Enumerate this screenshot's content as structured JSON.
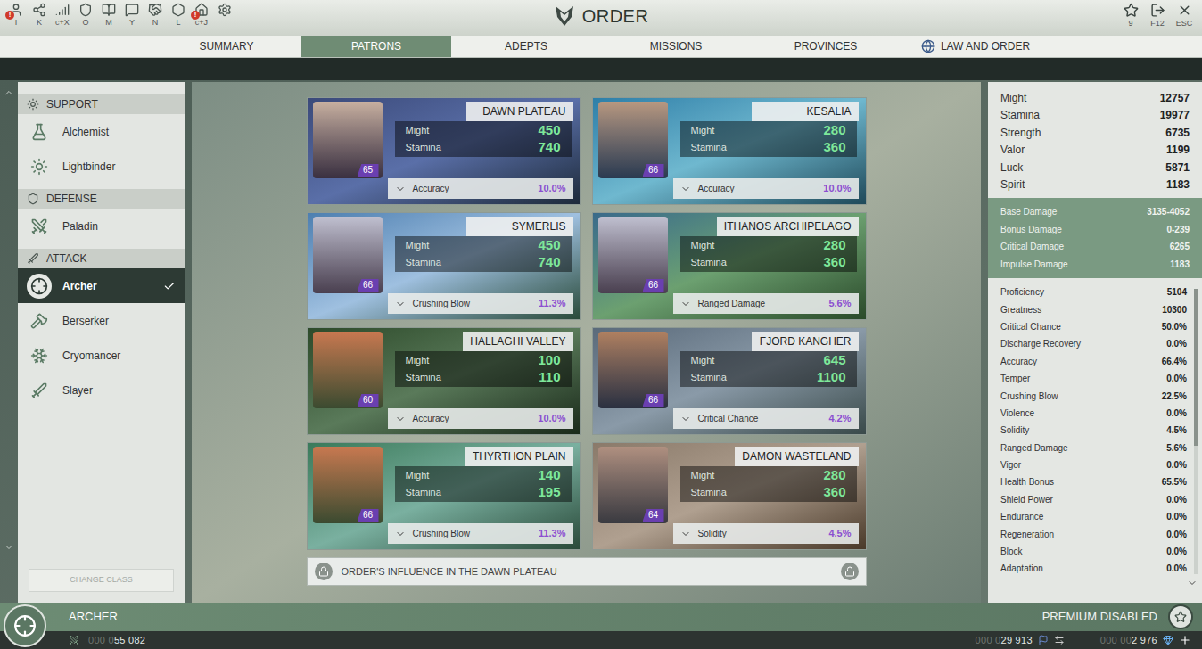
{
  "window": {
    "title": "ORDER"
  },
  "alert_badge": "!",
  "toolbar": [
    {
      "key": "I",
      "alert": true
    },
    {
      "key": "K",
      "alert": false
    },
    {
      "key": "c+X",
      "alert": false
    },
    {
      "key": "O",
      "alert": false
    },
    {
      "key": "M",
      "alert": false
    },
    {
      "key": "Y",
      "alert": false
    },
    {
      "key": "N",
      "alert": false
    },
    {
      "key": "L",
      "alert": false
    },
    {
      "key": "c+J",
      "alert": true
    },
    {
      "key": "",
      "alert": false
    }
  ],
  "window_buttons": [
    {
      "key": "9"
    },
    {
      "key": "F12"
    },
    {
      "key": "ESC"
    }
  ],
  "tabs": [
    {
      "label": "SUMMARY",
      "selected": false,
      "kind": "plain"
    },
    {
      "label": "PATRONS",
      "selected": true,
      "kind": "plain"
    },
    {
      "label": "ADEPTS",
      "selected": false,
      "kind": "plain"
    },
    {
      "label": "MISSIONS",
      "selected": false,
      "kind": "plain"
    },
    {
      "label": "PROVINCES",
      "selected": false,
      "kind": "plain"
    },
    {
      "label": "LAW AND ORDER",
      "selected": false,
      "kind": "globe"
    }
  ],
  "sidebar": {
    "groups": [
      {
        "title": "SUPPORT",
        "items": [
          {
            "label": "Alchemist",
            "selected": false
          },
          {
            "label": "Lightbinder",
            "selected": false
          }
        ]
      },
      {
        "title": "DEFENSE",
        "items": [
          {
            "label": "Paladin",
            "selected": false
          }
        ]
      },
      {
        "title": "ATTACK",
        "items": [
          {
            "label": "Archer",
            "selected": true
          },
          {
            "label": "Berserker",
            "selected": false
          },
          {
            "label": "Cryomancer",
            "selected": false
          },
          {
            "label": "Slayer",
            "selected": false
          }
        ]
      }
    ],
    "button": {
      "label": "CHANGE CLASS",
      "disabled": true
    }
  },
  "card_labels": {
    "might": "Might",
    "stamina": "Stamina"
  },
  "patrons": [
    {
      "name": "DAWN PLATEAU",
      "level": "65",
      "might": "450",
      "stamina": "740",
      "stat": "Accuracy",
      "value": "10.0%"
    },
    {
      "name": "KESALIA",
      "level": "66",
      "might": "280",
      "stamina": "360",
      "stat": "Accuracy",
      "value": "10.0%"
    },
    {
      "name": "SYMERLIS",
      "level": "66",
      "might": "450",
      "stamina": "740",
      "stat": "Crushing Blow",
      "value": "11.3%"
    },
    {
      "name": "ITHANOS ARCHIPELAGO",
      "level": "66",
      "might": "280",
      "stamina": "360",
      "stat": "Ranged Damage",
      "value": "5.6%"
    },
    {
      "name": "HALLAGHI VALLEY",
      "level": "60",
      "might": "100",
      "stamina": "110",
      "stat": "Accuracy",
      "value": "10.0%"
    },
    {
      "name": "FJORD KANGHER",
      "level": "66",
      "might": "645",
      "stamina": "1100",
      "stat": "Critical Chance",
      "value": "4.2%"
    },
    {
      "name": "THYRTHON PLAIN",
      "level": "66",
      "might": "140",
      "stamina": "195",
      "stat": "Crushing Blow",
      "value": "11.3%"
    },
    {
      "name": "DAMON WASTELAND",
      "level": "64",
      "might": "280",
      "stamina": "360",
      "stat": "Solidity",
      "value": "4.5%"
    }
  ],
  "influence": {
    "label": "ORDER'S INFLUENCE IN THE DAWN PLATEAU",
    "locked": true
  },
  "stats": {
    "main": [
      {
        "label": "Might",
        "value": "12757"
      },
      {
        "label": "Stamina",
        "value": "19977"
      },
      {
        "label": "Strength",
        "value": "6735"
      },
      {
        "label": "Valor",
        "value": "1199"
      },
      {
        "label": "Luck",
        "value": "5871"
      },
      {
        "label": "Spirit",
        "value": "1183"
      }
    ],
    "damage": [
      {
        "label": "Base Damage",
        "value": "3135-4052"
      },
      {
        "label": "Bonus Damage",
        "value": "0-239"
      },
      {
        "label": "Critical Damage",
        "value": "6265"
      },
      {
        "label": "Impulse Damage",
        "value": "1183"
      }
    ],
    "list": [
      {
        "label": "Proficiency",
        "value": "5104"
      },
      {
        "label": "Greatness",
        "value": "10300"
      },
      {
        "label": "Critical Chance",
        "value": "50.0%"
      },
      {
        "label": "Discharge Recovery",
        "value": "0.0%"
      },
      {
        "label": "Accuracy",
        "value": "66.4%"
      },
      {
        "label": "Temper",
        "value": "0.0%"
      },
      {
        "label": "Crushing Blow",
        "value": "22.5%"
      },
      {
        "label": "Violence",
        "value": "0.0%"
      },
      {
        "label": "Solidity",
        "value": "4.5%"
      },
      {
        "label": "Ranged Damage",
        "value": "5.6%"
      },
      {
        "label": "Vigor",
        "value": "0.0%"
      },
      {
        "label": "Health Bonus",
        "value": "65.5%"
      },
      {
        "label": "Shield Power",
        "value": "0.0%"
      },
      {
        "label": "Endurance",
        "value": "0.0%"
      },
      {
        "label": "Regeneration",
        "value": "0.0%"
      },
      {
        "label": "Block",
        "value": "0.0%"
      },
      {
        "label": "Adaptation",
        "value": "0.0%"
      }
    ],
    "scroll_level": 0.55
  },
  "status_bar": {
    "class_name": "ARCHER",
    "premium": "PREMIUM DISABLED",
    "currencies": [
      {
        "dim": "000 0",
        "value": "55 082"
      },
      {
        "dim": "000 0",
        "value": "29 913"
      },
      {
        "dim": "000 00",
        "value": "2 976"
      }
    ]
  }
}
